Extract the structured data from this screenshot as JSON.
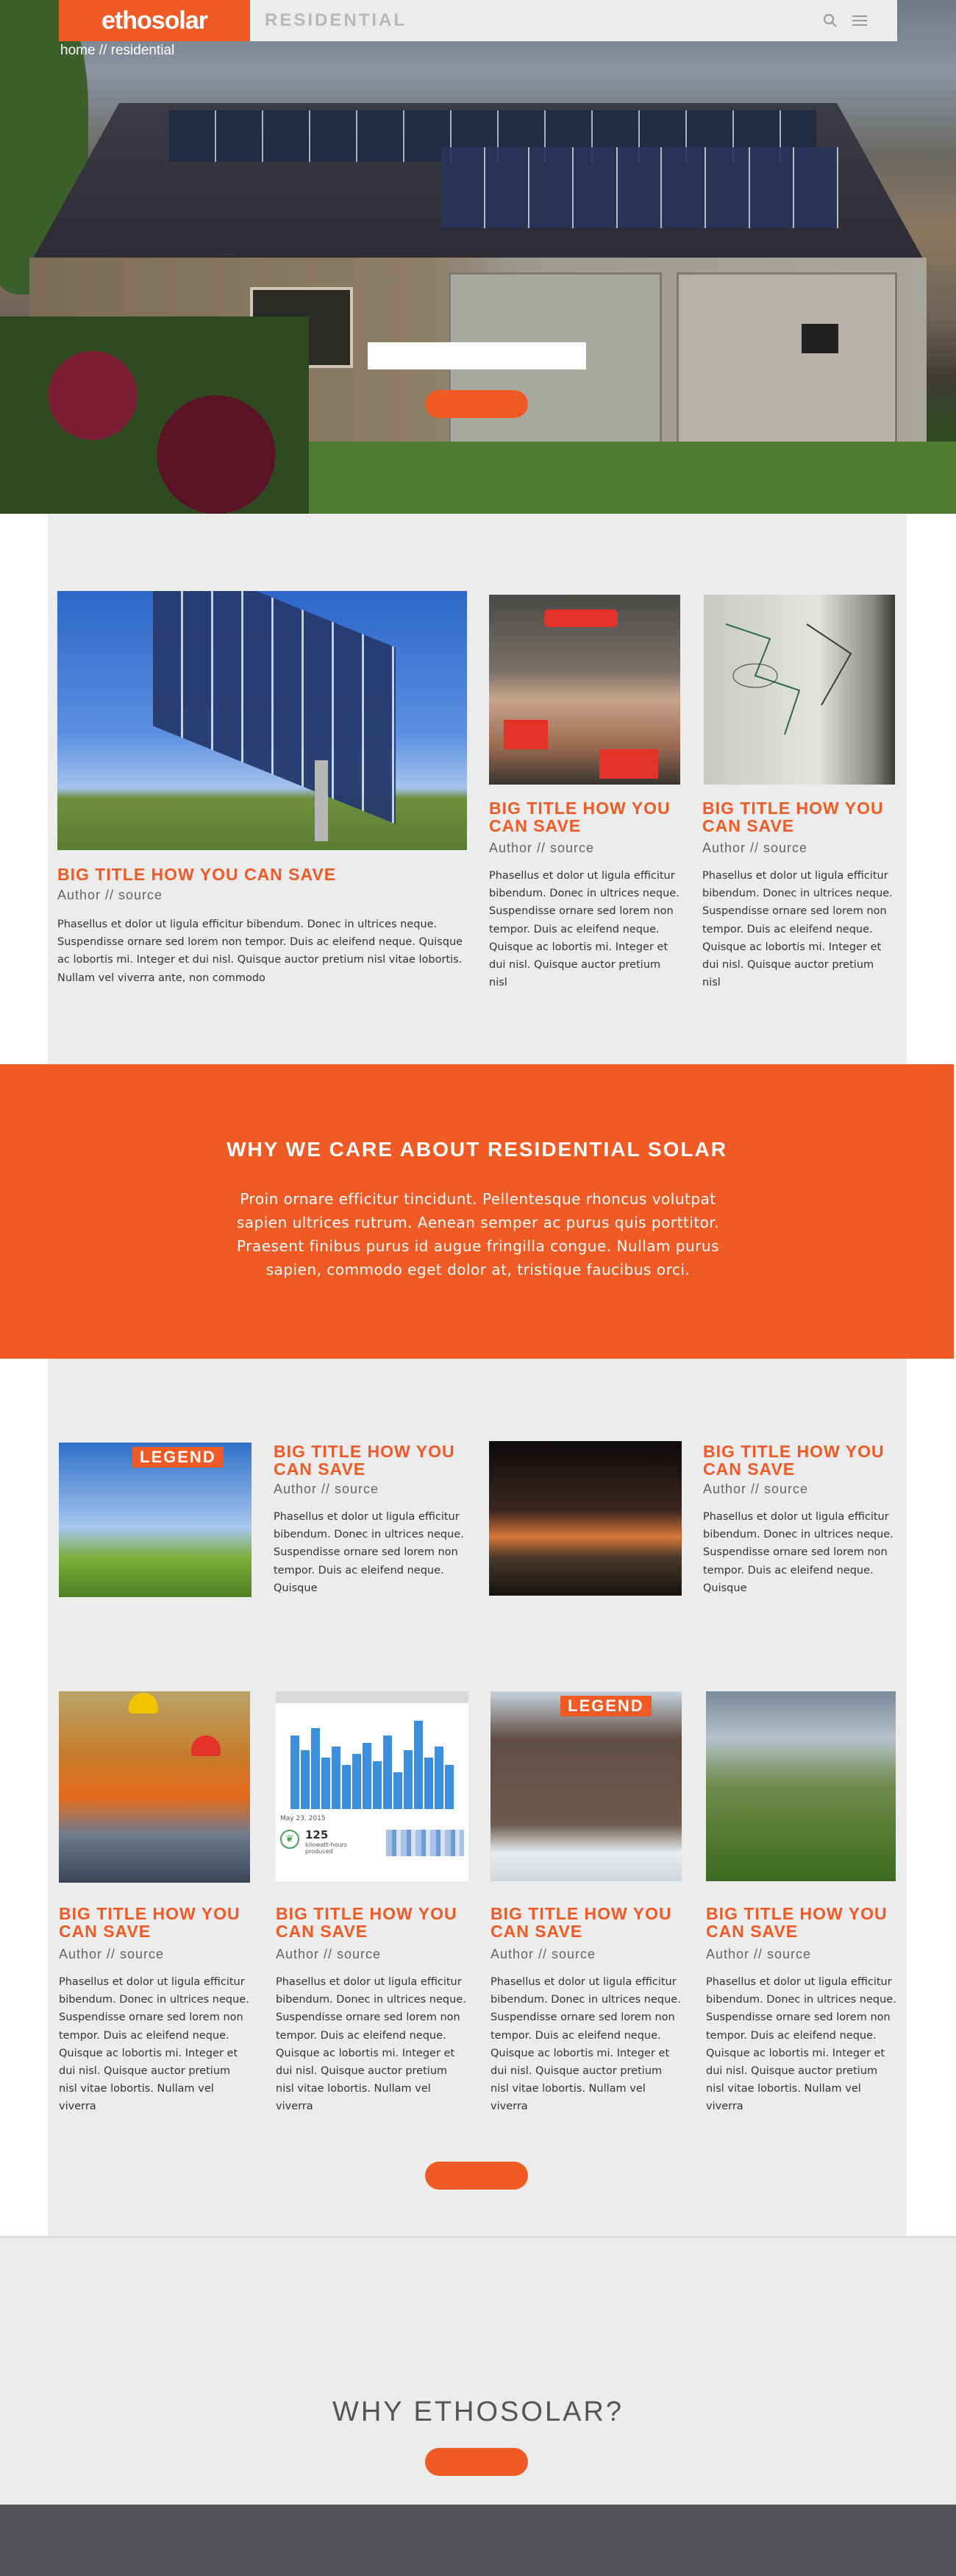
{
  "header": {
    "logo": "ethosolar",
    "section": "RESIDENTIAL",
    "search_icon": "search-icon",
    "menu_icon": "hamburger-menu-icon"
  },
  "breadcrumb": "home // residential",
  "colors": {
    "accent": "#f05a24",
    "panel": "#ececec",
    "footer": "#525256"
  },
  "featured": [
    {
      "title": "BIG TITLE HOW YOU CAN SAVE",
      "author": "Author // source",
      "body": "Phasellus et dolor ut ligula efficitur bibendum. Donec in ultrices neque. Suspendisse ornare sed lorem non tempor. Duis ac eleifend neque. Quisque ac lobortis mi. Integer et dui nisl. Quisque auctor pretium nisl vitae lobortis. Nullam vel viverra ante, non commodo"
    },
    {
      "title": "BIG TITLE HOW YOU CAN SAVE",
      "author": "Author // source",
      "body": "Phasellus et dolor ut ligula efficitur bibendum. Donec in ultrices neque. Suspendisse ornare sed lorem non tempor. Duis ac eleifend neque. Quisque ac lobortis mi. Integer et dui nisl. Quisque auctor pretium nisl"
    },
    {
      "title": "BIG TITLE HOW YOU CAN SAVE",
      "author": "Author // source",
      "body": "Phasellus et dolor ut ligula efficitur bibendum. Donec in ultrices neque. Suspendisse ornare sed lorem non tempor. Duis ac eleifend neque. Quisque ac lobortis mi. Integer et dui nisl. Quisque auctor pretium nisl"
    }
  ],
  "why_band": {
    "title": "WHY WE CARE ABOUT RESIDENTIAL SOLAR",
    "body": "Proin ornare efficitur tincidunt. Pellentesque rhoncus volutpat sapien ultrices rutrum. Aenean semper ac purus quis porttitor. Praesent finibus purus id augue fringilla congue. Nullam purus sapien, commodo eget dolor at, tristique faucibus orci."
  },
  "row2": [
    {
      "legend": "LEGEND",
      "title": "BIG TITLE HOW YOU CAN SAVE",
      "author": "Author // source",
      "body": "Phasellus et dolor ut ligula efficitur bibendum. Donec in ultrices neque. Suspendisse ornare sed lorem non tempor. Duis ac eleifend neque. Quisque"
    },
    {
      "title": "BIG TITLE HOW YOU CAN SAVE",
      "author": "Author // source",
      "body": "Phasellus et dolor ut ligula efficitur bibendum. Donec in ultrices neque. Suspendisse ornare sed lorem non tempor. Duis ac eleifend neque. Quisque"
    }
  ],
  "row3": [
    {
      "title": "BIG TITLE HOW YOU CAN SAVE",
      "author": "Author // source",
      "body": "Phasellus et dolor ut ligula efficitur bibendum. Donec in ultrices neque. Suspendisse ornare sed lorem non tempor. Duis ac eleifend neque. Quisque ac lobortis mi. Integer et dui nisl. Quisque auctor pretium nisl vitae lobortis. Nullam vel viverra"
    },
    {
      "title": "BIG TITLE HOW YOU CAN SAVE",
      "author": "Author // source",
      "body": "Phasellus et dolor ut ligula efficitur bibendum. Donec in ultrices neque. Suspendisse ornare sed lorem non tempor. Duis ac eleifend neque. Quisque ac lobortis mi. Integer et dui nisl. Quisque auctor pretium nisl vitae lobortis. Nullam vel viverra",
      "chart_date": "May 23, 2015",
      "chart_stat": "125",
      "chart_stat_label": "kilowatt-hours produced"
    },
    {
      "legend": "LEGEND",
      "title": "BIG TITLE HOW YOU CAN SAVE",
      "author": "Author // source",
      "body": "Phasellus et dolor ut ligula efficitur bibendum. Donec in ultrices neque. Suspendisse ornare sed lorem non tempor. Duis ac eleifend neque. Quisque ac lobortis mi. Integer et dui nisl. Quisque auctor pretium nisl vitae lobortis. Nullam vel viverra"
    },
    {
      "title": "BIG TITLE HOW YOU CAN SAVE",
      "author": "Author // source",
      "body": "Phasellus et dolor ut ligula efficitur bibendum. Donec in ultrices neque. Suspendisse ornare sed lorem non tempor. Duis ac eleifend neque. Quisque ac lobortis mi. Integer et dui nisl. Quisque auctor pretium nisl vitae lobortis. Nullam vel viverra"
    }
  ],
  "why_ethosolar": {
    "title": "WHY ETHOSOLAR?"
  }
}
